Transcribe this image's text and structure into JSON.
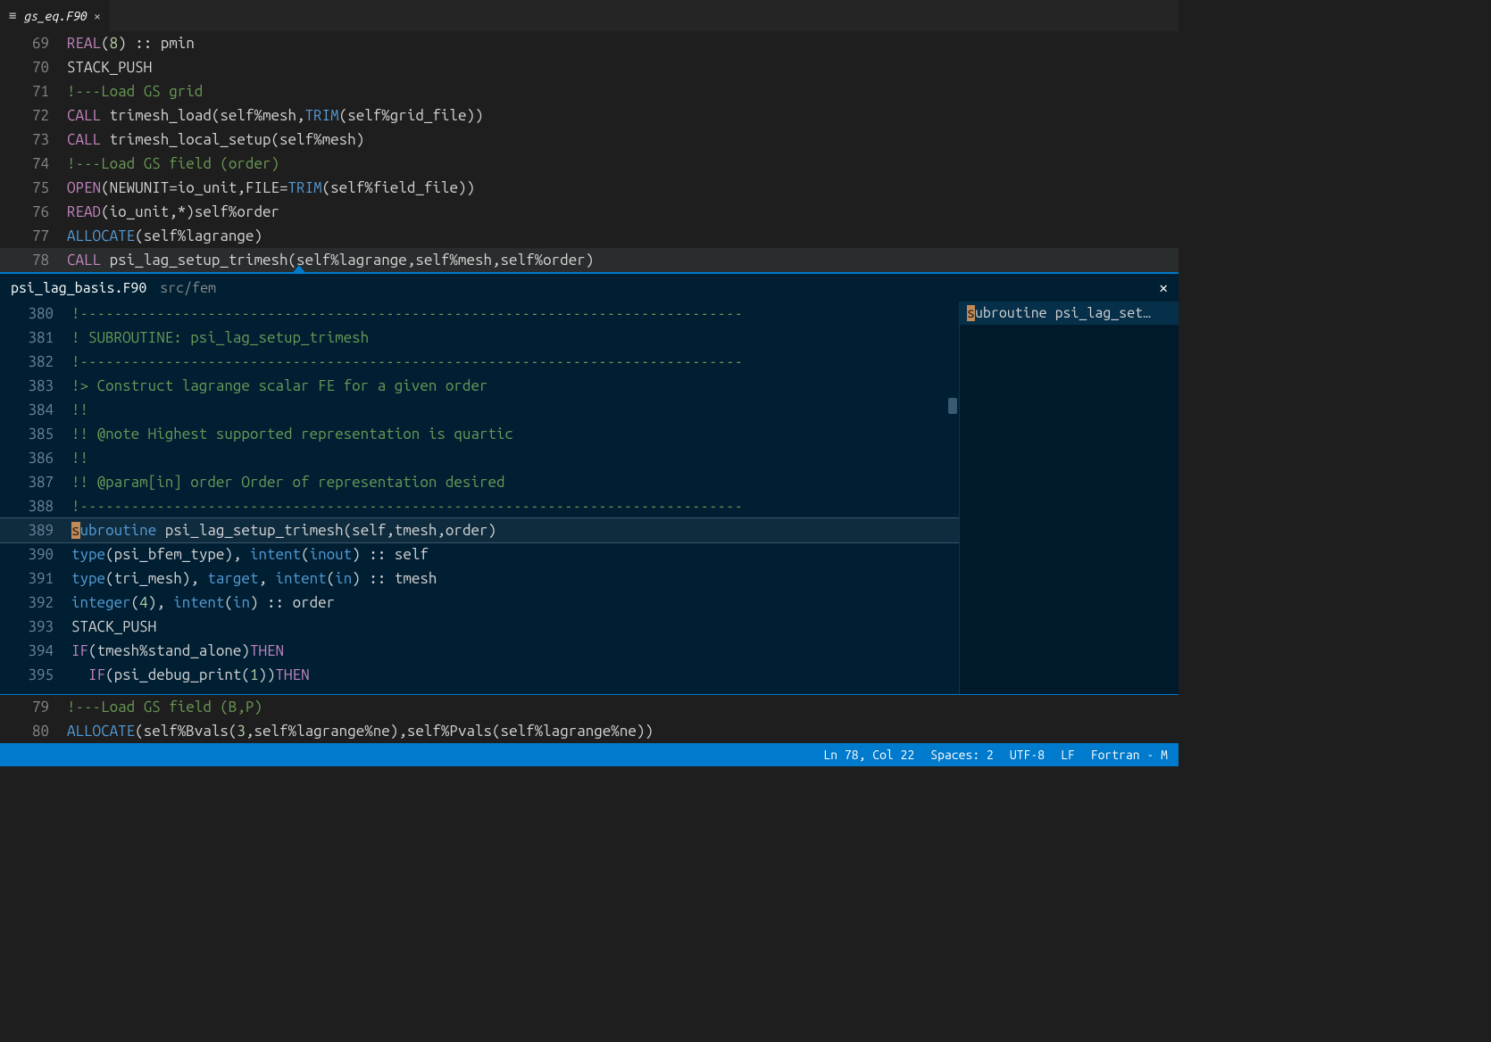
{
  "tab": {
    "filename": "gs_eq.F90"
  },
  "top_editor": {
    "lines": [
      {
        "n": 69,
        "html": "<span class='c-kw'>REAL</span>(<span class='c-num'>8</span>) :: pmin"
      },
      {
        "n": 70,
        "html": "STACK_PUSH"
      },
      {
        "n": 71,
        "html": "<span class='c-cmnt'>!---Load GS grid</span>"
      },
      {
        "n": 72,
        "html": "<span class='c-kw'>CALL</span> trimesh_load(self%mesh,<span class='c-type'>TRIM</span>(self%grid_file))"
      },
      {
        "n": 73,
        "html": "<span class='c-kw'>CALL</span> trimesh_local_setup(self%mesh)"
      },
      {
        "n": 74,
        "html": "<span class='c-cmnt'>!---Load GS field (order)</span>"
      },
      {
        "n": 75,
        "html": "<span class='c-kw'>OPEN</span>(NEWUNIT=io_unit,FILE=<span class='c-type'>TRIM</span>(self%field_file))"
      },
      {
        "n": 76,
        "html": "<span class='c-kw'>READ</span>(io_unit,*)self%order"
      },
      {
        "n": 77,
        "html": "<span class='c-type'>ALLOCATE</span>(self%lagrange)"
      },
      {
        "n": 78,
        "html": "<span class='c-kw'>CALL</span> psi_lag_setup_trimesh(self%lagrange,self%mesh,self%order)",
        "current": true
      }
    ]
  },
  "peek": {
    "file": "psi_lag_basis.F90",
    "path": "src/fem",
    "ref_label": "subroutine psi_lag_set…",
    "lines": [
      {
        "n": 380,
        "html": "<span class='c-cmnt'>!------------------------------------------------------------------------------</span>"
      },
      {
        "n": 381,
        "html": "<span class='c-cmnt'>! SUBROUTINE: psi_lag_setup_trimesh</span>"
      },
      {
        "n": 382,
        "html": "<span class='c-cmnt'>!------------------------------------------------------------------------------</span>"
      },
      {
        "n": 383,
        "html": "<span class='c-cmnt'>!> Construct lagrange scalar FE for a given order</span>"
      },
      {
        "n": 384,
        "html": "<span class='c-cmnt'>!!</span>"
      },
      {
        "n": 385,
        "html": "<span class='c-cmnt'>!! @note Highest supported representation is quartic</span>"
      },
      {
        "n": 386,
        "html": "<span class='c-cmnt'>!!</span>"
      },
      {
        "n": 387,
        "html": "<span class='c-cmnt'>!! @param[in] order Order of representation desired</span>"
      },
      {
        "n": 388,
        "html": "<span class='c-cmnt'>!------------------------------------------------------------------------------</span>"
      },
      {
        "n": 389,
        "html": "<span class='hl-char'>s</span><span class='c-type'>ubroutine</span> psi_lag_setup_trimesh(self,tmesh,order)",
        "current": true
      },
      {
        "n": 390,
        "html": "<span class='c-type'>type</span>(psi_bfem_type), <span class='c-type'>intent</span>(<span class='c-type'>inout</span>) :: self"
      },
      {
        "n": 391,
        "html": "<span class='c-type'>type</span>(tri_mesh), <span class='c-type'>target</span>, <span class='c-type'>intent</span>(<span class='c-type'>in</span>) :: tmesh"
      },
      {
        "n": 392,
        "html": "<span class='c-type'>integer</span>(<span class='c-num'>4</span>), <span class='c-type'>intent</span>(<span class='c-type'>in</span>) :: order"
      },
      {
        "n": 393,
        "html": "STACK_PUSH"
      },
      {
        "n": 394,
        "html": "<span class='c-kw'>IF</span>(tmesh%stand_alone)<span class='c-kw'>THEN</span>"
      },
      {
        "n": 395,
        "html": "  <span class='c-kw'>IF</span>(psi_debug_print(<span class='c-num'>1</span>))<span class='c-kw'>THEN</span>"
      }
    ]
  },
  "bottom_editor": {
    "lines": [
      {
        "n": 79,
        "html": "<span class='c-cmnt'>!---Load GS field (B,P)</span>"
      },
      {
        "n": 80,
        "html": "<span class='c-type'>ALLOCATE</span>(self%Bvals(<span class='c-num'>3</span>,self%lagrange%ne),self%Pvals(self%lagrange%ne))"
      }
    ]
  },
  "status": {
    "position": "Ln 78, Col 22",
    "spaces": "Spaces: 2",
    "encoding": "UTF-8",
    "eol": "LF",
    "language": "Fortran - M"
  }
}
